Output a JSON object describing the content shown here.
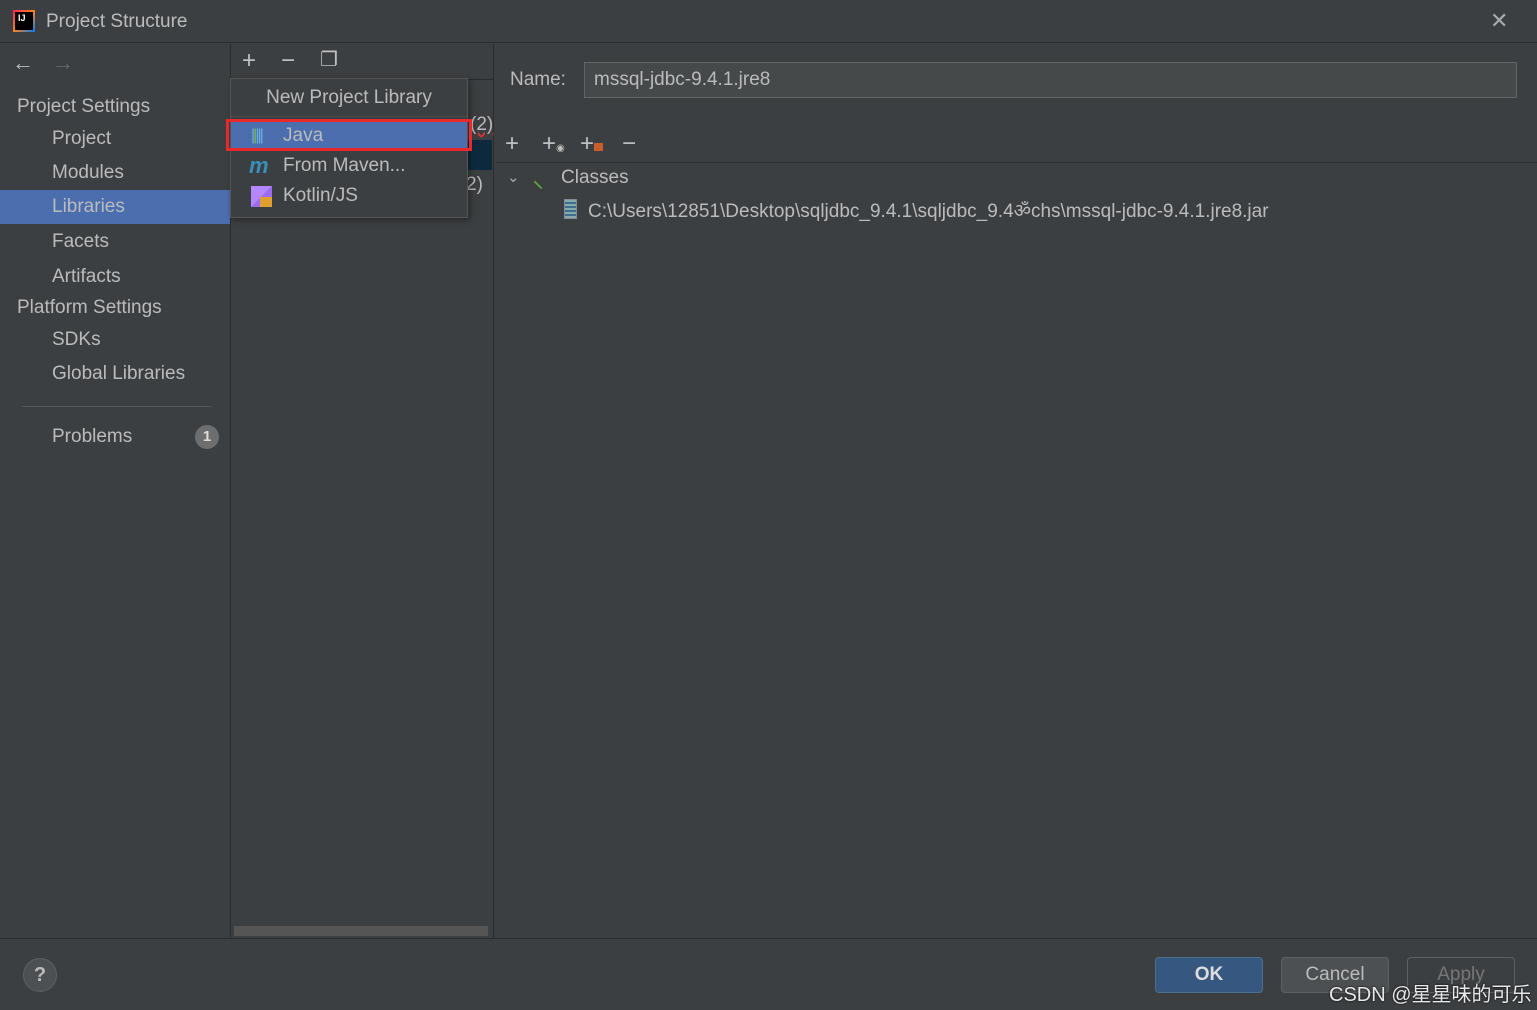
{
  "window": {
    "title": "Project Structure",
    "app_icon": "IJ"
  },
  "sidebar": {
    "sections": [
      {
        "label": "Project Settings",
        "items": [
          {
            "label": "Project"
          },
          {
            "label": "Modules"
          },
          {
            "label": "Libraries",
            "selected": true
          },
          {
            "label": "Facets"
          },
          {
            "label": "Artifacts"
          }
        ]
      },
      {
        "label": "Platform Settings",
        "items": [
          {
            "label": "SDKs"
          },
          {
            "label": "Global Libraries"
          }
        ]
      }
    ],
    "problems": {
      "label": "Problems",
      "count": "1"
    }
  },
  "middle": {
    "partial_rows": [
      "(2)",
      "2)"
    ]
  },
  "popup": {
    "title": "New Project Library",
    "items": [
      {
        "label": "Java",
        "selected": true
      },
      {
        "label": "From Maven..."
      },
      {
        "label": "Kotlin/JS"
      }
    ]
  },
  "detail": {
    "name_label": "Name:",
    "name_value": "mssql-jdbc-9.4.1.jre8",
    "tree": {
      "root": "Classes",
      "children": [
        "C:\\Users\\12851\\Desktop\\sqljdbc_9.4.1\\sqljdbc_9.4ॐchs\\mssql-jdbc-9.4.1.jre8.jar"
      ]
    }
  },
  "footer": {
    "help": "?",
    "ok": "OK",
    "cancel": "Cancel",
    "apply": "Apply"
  },
  "watermark": "CSDN @星星味的可乐",
  "colors": {
    "selection": "#4b6eaf",
    "highlight_box": "#e8282a",
    "ok_button": "#365880"
  }
}
